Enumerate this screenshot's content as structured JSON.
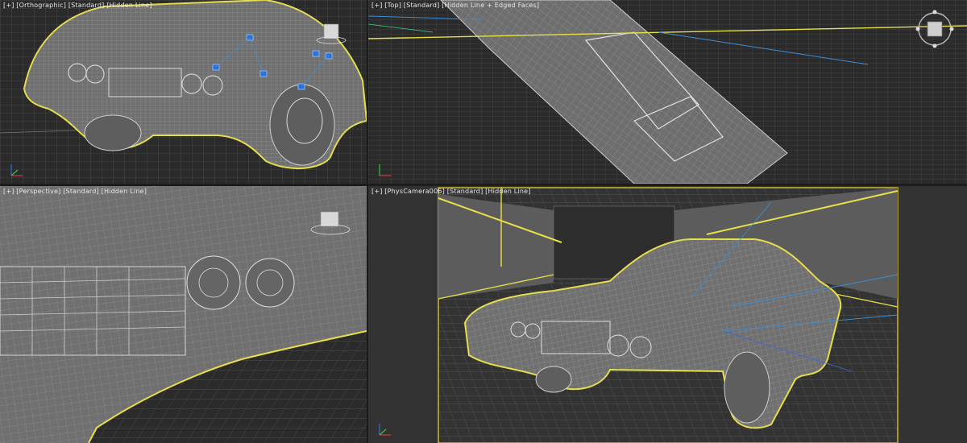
{
  "viewports": {
    "top_left": {
      "label_plus": "[+]",
      "label_view": "[Orthographic]",
      "label_shading": "[Standard]",
      "label_mode": "[Hidden Line]"
    },
    "top_right": {
      "label_plus": "[+]",
      "label_view": "[Top]",
      "label_shading": "[Standard]",
      "label_mode": "[Hidden Line + Edged Faces]"
    },
    "bottom_left": {
      "label_plus": "[+]",
      "label_view": "[Perspective]",
      "label_shading": "[Standard]",
      "label_mode": "[Hidden Line]"
    },
    "bottom_right": {
      "label_plus": "[+]",
      "label_view": "[PhysCamera006]",
      "label_shading": "[Standard]",
      "label_mode": "[Hidden Line]"
    }
  },
  "colors": {
    "selection": "#e8e04a",
    "wire": "#bfbfbf",
    "background": "#2b2b2b",
    "helper_blue": "#3b8fd6",
    "axis_x": "#d23c3c",
    "axis_y": "#3cc23c",
    "axis_z": "#3c6ad2"
  },
  "icons": {
    "viewcube": "viewcube-icon",
    "axis": "axis-tripod-icon"
  }
}
